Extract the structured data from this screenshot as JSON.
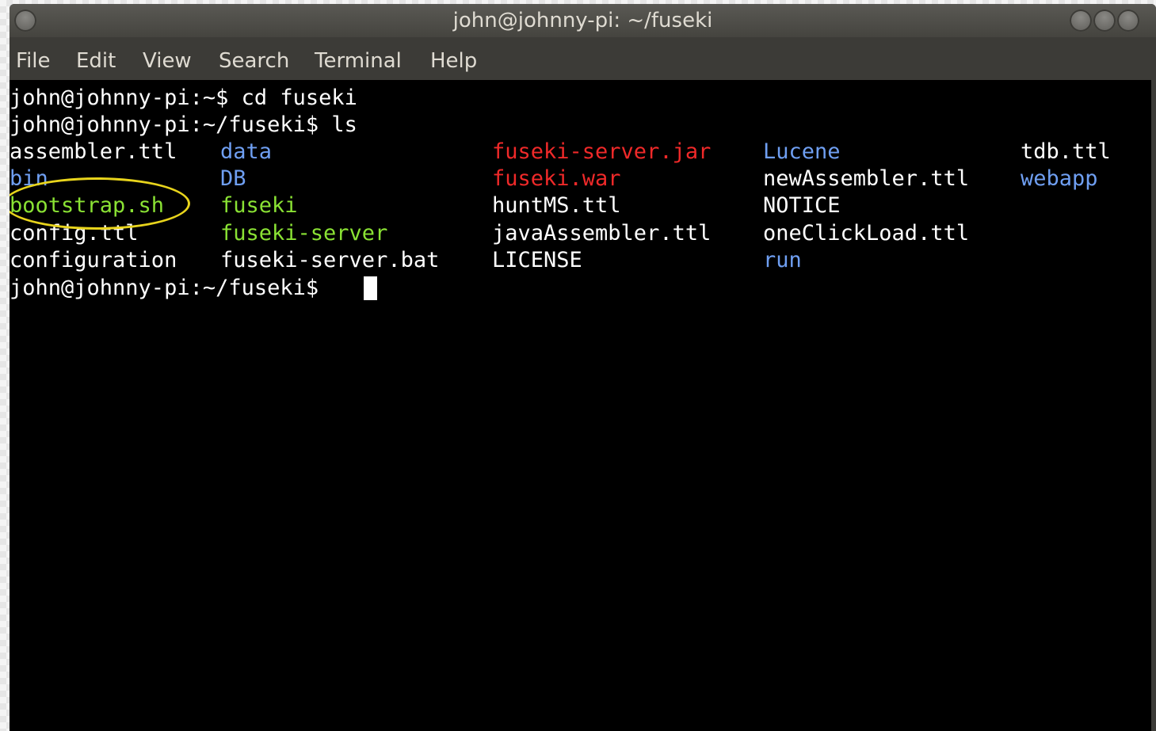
{
  "window": {
    "title": "john@johnny-pi: ~/fuseki"
  },
  "menu": {
    "items": [
      "File",
      "Edit",
      "View",
      "Search",
      "Terminal",
      "Help"
    ]
  },
  "colors": {
    "plain": "#ffffff",
    "directory": "#6f9ff2",
    "executable": "#8ae234",
    "archive": "#ef2929",
    "highlight": "#e8d41c"
  },
  "terminal": {
    "prompt_lines": [
      "john@johnny-pi:~$ cd fuseki",
      "john@johnny-pi:~/fuseki$ ls"
    ],
    "listing": [
      [
        {
          "name": "assembler.ttl",
          "kind": "plain"
        },
        {
          "name": "data",
          "kind": "directory"
        },
        {
          "name": "fuseki-server.jar",
          "kind": "archive"
        },
        {
          "name": "Lucene",
          "kind": "directory"
        },
        {
          "name": "tdb.ttl",
          "kind": "plain"
        }
      ],
      [
        {
          "name": "bin",
          "kind": "directory"
        },
        {
          "name": "DB",
          "kind": "directory"
        },
        {
          "name": "fuseki.war",
          "kind": "archive"
        },
        {
          "name": "newAssembler.ttl",
          "kind": "plain"
        },
        {
          "name": "webapp",
          "kind": "directory"
        }
      ],
      [
        {
          "name": "bootstrap.sh",
          "kind": "executable"
        },
        {
          "name": "fuseki",
          "kind": "executable"
        },
        {
          "name": "huntMS.ttl",
          "kind": "plain"
        },
        {
          "name": "NOTICE",
          "kind": "plain"
        },
        {
          "name": "",
          "kind": "plain"
        }
      ],
      [
        {
          "name": "config.ttl",
          "kind": "plain"
        },
        {
          "name": "fuseki-server",
          "kind": "executable"
        },
        {
          "name": "javaAssembler.ttl",
          "kind": "plain"
        },
        {
          "name": "oneClickLoad.ttl",
          "kind": "plain"
        },
        {
          "name": "",
          "kind": "plain"
        }
      ],
      [
        {
          "name": "configuration",
          "kind": "plain"
        },
        {
          "name": "fuseki-server.bat",
          "kind": "plain"
        },
        {
          "name": "LICENSE",
          "kind": "plain"
        },
        {
          "name": "run",
          "kind": "directory"
        },
        {
          "name": "",
          "kind": "plain"
        }
      ]
    ],
    "final_prompt": "john@johnny-pi:~/fuseki$ "
  }
}
